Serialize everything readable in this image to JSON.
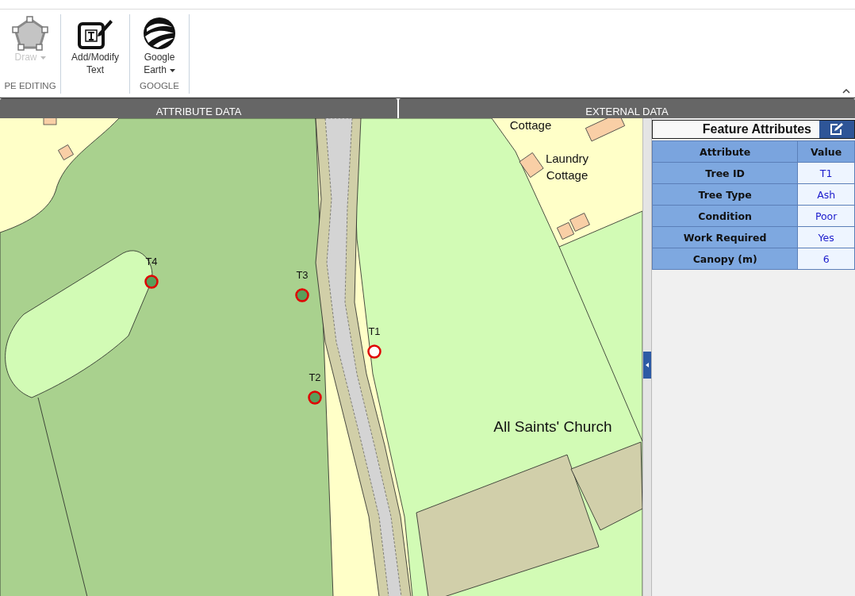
{
  "ribbon": {
    "groups": [
      {
        "label": "PE EDITING",
        "buttons": [
          {
            "kind": "pentagon",
            "label": "Draw",
            "disabled": true,
            "dropdown": true
          }
        ]
      },
      {
        "buttons": [
          {
            "kind": "text-edit",
            "label": "Add/Modify Text",
            "disabled": false,
            "dropdown": false
          }
        ]
      },
      {
        "label": "GOOGLE",
        "buttons": [
          {
            "kind": "globe",
            "label": "Google Earth",
            "disabled": false,
            "dropdown": true
          }
        ]
      }
    ]
  },
  "tabs": [
    {
      "label": "ATTRIBUTE DATA"
    },
    {
      "label": "EXTERNAL DATA"
    }
  ],
  "map": {
    "labels": [
      {
        "kind": "place",
        "text": "Cottage"
      },
      {
        "kind": "place",
        "text": "Laundry Cottage"
      },
      {
        "kind": "church",
        "text": "All Saints' Church"
      }
    ],
    "trees": [
      {
        "label": "T4",
        "selected": false
      },
      {
        "label": "T3",
        "selected": false
      },
      {
        "label": "T1",
        "selected": true
      },
      {
        "label": "T2",
        "selected": false
      }
    ]
  },
  "panel": {
    "title": "Feature Attributes",
    "columns": [
      "Attribute",
      "Value"
    ],
    "rows": [
      [
        "Tree ID",
        "T1"
      ],
      [
        "Tree Type",
        "Ash"
      ],
      [
        "Condition",
        "Poor"
      ],
      [
        "Work Required",
        "Yes"
      ],
      [
        "Canopy (m)",
        "6"
      ]
    ]
  }
}
